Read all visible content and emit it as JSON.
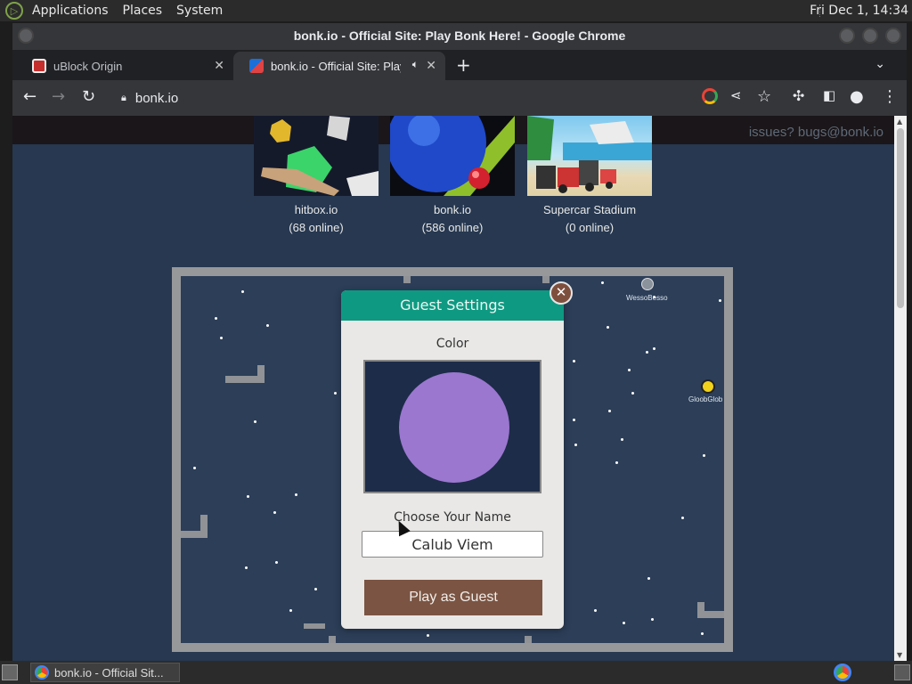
{
  "top_panel": {
    "menus": [
      "Applications",
      "Places",
      "System"
    ],
    "clock": "Fri Dec 1, 14:34"
  },
  "window": {
    "title": "bonk.io - Official Site: Play Bonk Here! - Google Chrome"
  },
  "tabs": [
    {
      "label": "uBlock Origin",
      "active": false
    },
    {
      "label": "bonk.io - Official Site: Play",
      "active": true
    }
  ],
  "toolbar": {
    "url": "bonk.io"
  },
  "page": {
    "issues_link": "issues? bugs@bonk.io",
    "games": [
      {
        "name": "hitbox.io",
        "online": "(68 online)"
      },
      {
        "name": "bonk.io",
        "online": "(586 online)"
      },
      {
        "name": "Supercar Stadium",
        "online": "(0 online)"
      }
    ],
    "players": [
      "WessoBesso",
      "GloobGlob"
    ]
  },
  "modal": {
    "title": "Guest Settings",
    "color_label": "Color",
    "color_value": "#9b77d0",
    "name_label": "Choose Your Name",
    "name_value": "Calub Viem",
    "play_button": "Play as Guest"
  },
  "taskbar": {
    "task_label": "bonk.io - Official Sit..."
  },
  "colors": {
    "modal_header": "#0e9a82",
    "play_button": "#7b5443",
    "arena_bg": "#2c3e58"
  }
}
